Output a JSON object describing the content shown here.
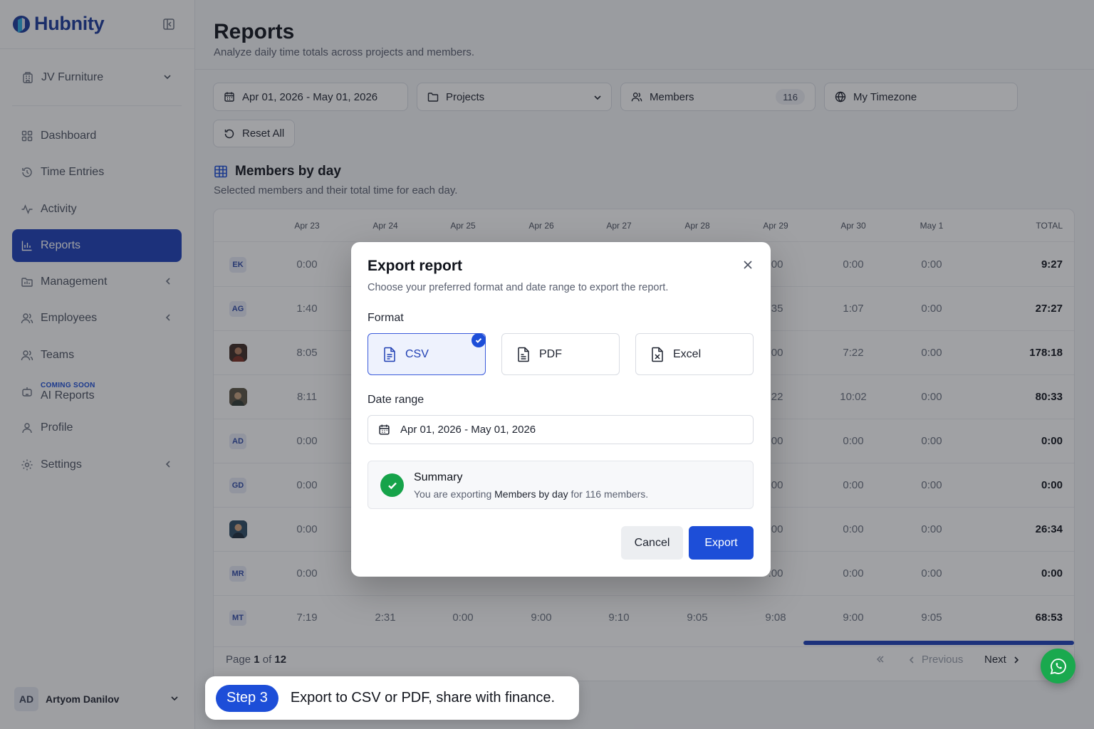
{
  "brand": {
    "name": "Hubnity"
  },
  "sidebar": {
    "org": "JV Furniture",
    "items": [
      {
        "label": "Dashboard"
      },
      {
        "label": "Time Entries"
      },
      {
        "label": "Activity"
      },
      {
        "label": "Reports",
        "active": true
      },
      {
        "label": "Management"
      },
      {
        "label": "Employees"
      },
      {
        "label": "Teams"
      },
      {
        "label": "AI Reports",
        "tag": "COMING SOON"
      },
      {
        "label": "Profile"
      },
      {
        "label": "Settings"
      }
    ],
    "user": {
      "initials": "AD",
      "name": "Artyom Danilov"
    }
  },
  "header": {
    "title": "Reports",
    "subtitle": "Analyze daily time totals across projects and members."
  },
  "filters": {
    "date_range": "Apr 01, 2026 - May 01, 2026",
    "projects": "Projects",
    "members": "Members",
    "members_count": "116",
    "timezone": "My Timezone",
    "reset": "Reset All"
  },
  "section": {
    "title": "Members by day",
    "subtitle": "Selected members and their total time for each day."
  },
  "table": {
    "columns": [
      "Apr 23",
      "Apr 24",
      "Apr 25",
      "Apr 26",
      "Apr 27",
      "Apr 28",
      "Apr 29",
      "Apr 30",
      "May 1"
    ],
    "total_label": "TOTAL",
    "rows": [
      {
        "member": "EK",
        "cells": [
          "0:00",
          "",
          "",
          "",
          "",
          "",
          ":00",
          "0:00",
          "0:00"
        ],
        "total": "9:27"
      },
      {
        "member": "AG",
        "cells": [
          "1:40",
          "",
          "",
          "",
          "",
          "",
          ":35",
          "1:07",
          "0:00"
        ],
        "total": "27:27"
      },
      {
        "member": "",
        "cells": [
          "8:05",
          "",
          "",
          "",
          "",
          "",
          ":00",
          "7:22",
          "0:00"
        ],
        "total": "178:18"
      },
      {
        "member": "",
        "cells": [
          "8:11",
          "",
          "",
          "",
          "",
          "",
          ":22",
          "10:02",
          "0:00"
        ],
        "total": "80:33"
      },
      {
        "member": "AD",
        "cells": [
          "0:00",
          "",
          "",
          "",
          "",
          "",
          ":00",
          "0:00",
          "0:00"
        ],
        "total": "0:00"
      },
      {
        "member": "GD",
        "cells": [
          "0:00",
          "",
          "",
          "",
          "",
          "",
          ":00",
          "0:00",
          "0:00"
        ],
        "total": "0:00"
      },
      {
        "member": "",
        "cells": [
          "0:00",
          "",
          "",
          "",
          "",
          "",
          ":00",
          "0:00",
          "0:00"
        ],
        "total": "26:34"
      },
      {
        "member": "MR",
        "cells": [
          "0:00",
          "",
          "",
          "",
          "",
          "",
          ":00",
          "0:00",
          "0:00"
        ],
        "total": "0:00"
      },
      {
        "member": "MT",
        "cells": [
          "7:19",
          "2:31",
          "0:00",
          "9:00",
          "9:10",
          "9:05",
          "9:08",
          "9:00",
          "9:05"
        ],
        "total": "68:53"
      }
    ],
    "pager": {
      "page_word": "Page",
      "current": "1",
      "of_word": "of",
      "total": "12",
      "previous": "Previous",
      "next": "Next"
    }
  },
  "modal": {
    "title": "Export report",
    "description": "Choose your preferred format and date range to export the report.",
    "format_label": "Format",
    "formats": [
      {
        "label": "CSV",
        "selected": true
      },
      {
        "label": "PDF",
        "selected": false
      },
      {
        "label": "Excel",
        "selected": false
      }
    ],
    "date_label": "Date range",
    "date_value": "Apr 01, 2026 - May 01, 2026",
    "summary": {
      "title": "Summary",
      "prefix": "You are exporting",
      "report": "Members by day",
      "middle": "for",
      "count": "116",
      "suffix": "members."
    },
    "cancel": "Cancel",
    "export": "Export"
  },
  "callout": {
    "step": "Step 3",
    "text": "Export to CSV or PDF, share with finance."
  },
  "colors": {
    "primary": "#1d4ed8",
    "sidebar_active": "#1d3fb8",
    "success": "#16a34a",
    "whatsapp": "#1aa94e"
  },
  "icons": [
    "logo-icon",
    "sidebar-collapse-icon",
    "building-icon",
    "dashboard-icon",
    "clock-history-icon",
    "activity-icon",
    "bar-chart-icon",
    "folder-icon",
    "users-icon",
    "user-icon",
    "robot-icon",
    "gear-icon",
    "calendar-icon",
    "globe-icon",
    "reset-icon",
    "table-icon",
    "file-csv-icon",
    "file-pdf-icon",
    "file-excel-icon",
    "close-icon",
    "check-icon",
    "whatsapp-icon"
  ]
}
